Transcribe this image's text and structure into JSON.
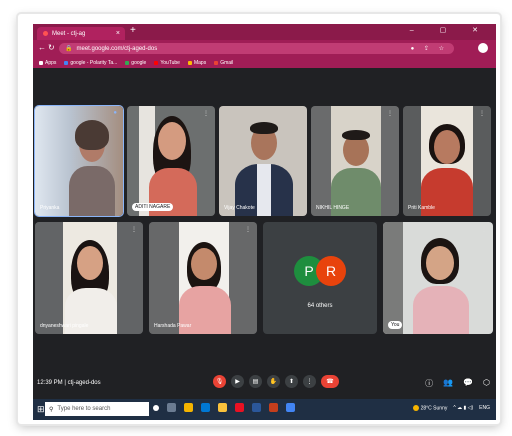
{
  "browser": {
    "tab_title": "Meet - ctj-ag",
    "tab_close": "×",
    "new_tab": "+",
    "window_controls": "–  ▢  ✕",
    "url": "meet.google.com/ctj-aged-dos",
    "bookmarks": [
      {
        "label": "Apps",
        "color": "#ffffff"
      },
      {
        "label": "google - Polarity Ta...",
        "color": "#4285f4"
      },
      {
        "label": "google",
        "color": "#34a853"
      },
      {
        "label": "YouTube",
        "color": "#ff0000"
      },
      {
        "label": "Maps",
        "color": "#fbbc04"
      },
      {
        "label": "Gmail",
        "color": "#ea4335"
      }
    ]
  },
  "meeting": {
    "participants": [
      {
        "name": "Priyanka",
        "pill": false,
        "selected": true
      },
      {
        "name": "ADITI NAGARE",
        "pill": true,
        "selected": false
      },
      {
        "name": "Vijay Chakote",
        "pill": false,
        "selected": false
      },
      {
        "name": "NIKHIL HINGE",
        "pill": false,
        "selected": false
      },
      {
        "name": "Priti Kamble",
        "pill": false,
        "selected": false
      },
      {
        "name": "dnyaneshwari pingale",
        "pill": false,
        "selected": false
      },
      {
        "name": "Harshada Pawar",
        "pill": false,
        "selected": false
      },
      {
        "name": "You",
        "pill": true,
        "selected": false
      }
    ],
    "others": {
      "initials": [
        "P",
        "R"
      ],
      "label": "64 others"
    },
    "time": "12:39 PM",
    "separator": "|",
    "code": "ctj-aged-dos",
    "more": "⋮"
  },
  "taskbar": {
    "search_placeholder": "Type here to search",
    "weather": "28°C Sunny",
    "lang": "ENG"
  },
  "colors": {
    "tab_bar": "#8b1a4a",
    "meet_bg": "#202124",
    "tile_bg": "#3c4043",
    "leave_red": "#ea4335"
  }
}
